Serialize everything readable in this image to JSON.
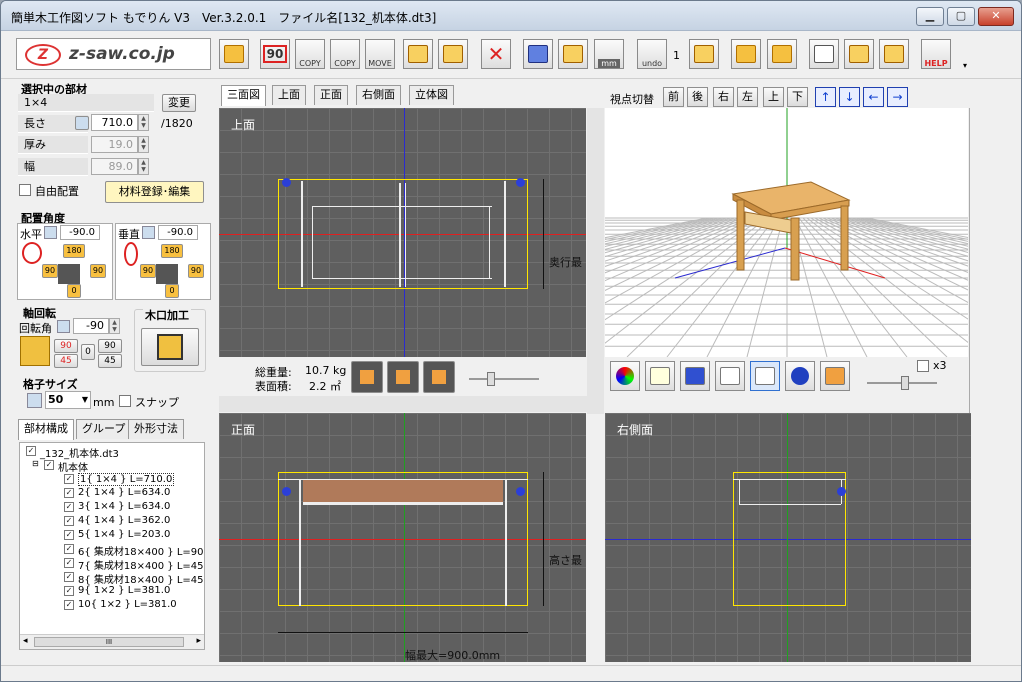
{
  "window": {
    "title": "簡単木工作図ソフト もでりん V3　Ver.3.2.0.1　ファイル名[132_机本体.dt3]",
    "minimize": "▁",
    "maximize": "▢",
    "close": "✕"
  },
  "logo": {
    "mark": "Z",
    "text": "z-saw.co.jp"
  },
  "toolbar": {
    "btn90": "90",
    "copy1": "COPY",
    "copy2": "COPY",
    "move": "MOVE",
    "mm": "mm",
    "undo": "undo",
    "undo_count": "1",
    "help": "HELP"
  },
  "left": {
    "selected_title": "選択中の部材",
    "part_name": "1×4",
    "change_btn": "変更",
    "length_label": "長さ",
    "length_value": "710.0",
    "length_max": "/1820",
    "thickness_label": "厚み",
    "thickness_value": "19.0",
    "width_label": "幅",
    "width_value": "89.0",
    "free_place": "自由配置",
    "material_btn": "材料登録･編集",
    "angle_title": "配置角度",
    "horizontal_label": "水平",
    "horizontal_value": "-90.0",
    "vertical_label": "垂直",
    "vertical_value": "-90.0",
    "axis_title": "軸回転",
    "rotation_label": "回転角",
    "rotation_value": "-90",
    "kiguchi_title": "木口加工",
    "rot90": "90",
    "rot45": "45",
    "rot0": "0",
    "rot90b": "90",
    "rot45b": "45",
    "a180": "180",
    "a90l": "90",
    "a90r": "90",
    "a0": "0",
    "b180": "180",
    "b90l": "90",
    "b90r": "90",
    "b0": "0",
    "grid_title": "格子サイズ",
    "grid_value": "50",
    "grid_unit": "mm",
    "snap": "スナップ"
  },
  "tree_tabs": [
    "部材構成",
    "グループ",
    "外形寸法"
  ],
  "tree": {
    "root": "_132_机本体.dt3",
    "group": "机本体",
    "items": [
      "1{ 1×4 } L=710.0",
      "2{ 1×4 } L=634.0",
      "3{ 1×4 } L=634.0",
      "4{ 1×4 } L=362.0",
      "5{ 1×4 } L=203.0",
      "6{ 集成材18×400 } L=90",
      "7{ 集成材18×400 } L=45",
      "8{ 集成材18×400 } L=45",
      "9{ 1×2 } L=381.0",
      "10{ 1×2 } L=381.0"
    ],
    "scroll_mid": "III"
  },
  "view_tabs": [
    "三面図",
    "上面",
    "正面",
    "右側面",
    "立体図"
  ],
  "views": {
    "top": "上面",
    "front": "正面",
    "right": "右側面",
    "depth_label": "奥行最",
    "height_label": "高さ最",
    "width_label": "幅最大=900.0mm"
  },
  "viewpoint": {
    "label": "視点切替",
    "buttons": [
      "前",
      "後",
      "右",
      "左",
      "上",
      "下"
    ],
    "arrows": [
      "↑",
      "↓",
      "←",
      "→"
    ]
  },
  "info": {
    "weight_label": "総重量:",
    "weight_value": "10.7 kg",
    "area_label": "表面積:",
    "area_value": "2.2 ㎡"
  },
  "x3": "x3"
}
